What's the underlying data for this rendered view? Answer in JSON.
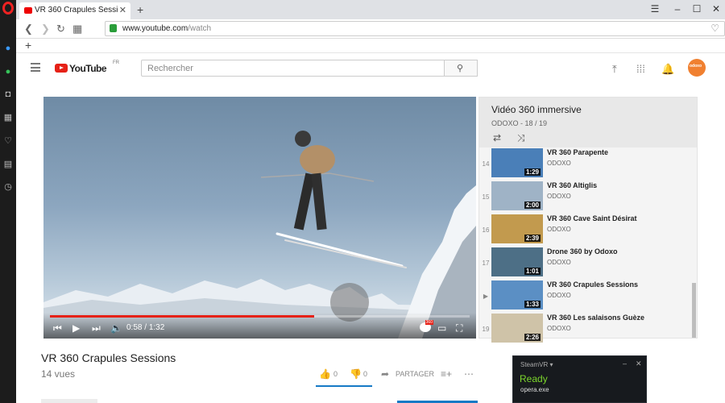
{
  "browser": {
    "tab": {
      "title": "VR 360 Crapules Sessions"
    },
    "url": {
      "domain": "www.youtube.com",
      "path": "/watch"
    }
  },
  "youtube": {
    "logo_text": "YouTube",
    "country": "FR",
    "search_placeholder": "Rechercher",
    "account_name": "odoxo"
  },
  "player": {
    "current_time": "0:58",
    "duration": "1:32",
    "progress_fraction": 0.63,
    "badge_360": "360"
  },
  "playlist": {
    "title": "Vidéo 360 immersive",
    "subtitle": "ODOXO - 18 / 19",
    "items": [
      {
        "index": "14",
        "name": "VR 360 Parapente",
        "channel": "ODOXO",
        "duration": "1:29",
        "color": "#4a7fb8"
      },
      {
        "index": "15",
        "name": "VR 360 Altiglis",
        "channel": "ODOXO",
        "duration": "2:00",
        "color": "#9fb3c6"
      },
      {
        "index": "16",
        "name": "VR 360 Cave Saint Désirat",
        "channel": "ODOXO",
        "duration": "2:39",
        "color": "#c29a4e"
      },
      {
        "index": "17",
        "name": "Drone 360 by Odoxo",
        "channel": "ODOXO",
        "duration": "1:01",
        "color": "#4d6f86"
      },
      {
        "index": "▶",
        "name": "VR 360 Crapules Sessions",
        "channel": "ODOXO",
        "duration": "1:33",
        "color": "#5b8fc4"
      },
      {
        "index": "19",
        "name": "VR 360 Les salaisons Guèze",
        "channel": "ODOXO",
        "duration": "2:26",
        "color": "#cfc3a8"
      }
    ]
  },
  "video": {
    "title": "VR 360 Crapules Sessions",
    "views": "14 vues",
    "likes": "0",
    "dislikes": "0",
    "share_label": "PARTAGER"
  },
  "steamvr": {
    "title": "SteamVR ▾",
    "status": "Ready",
    "app": "opera.exe"
  }
}
